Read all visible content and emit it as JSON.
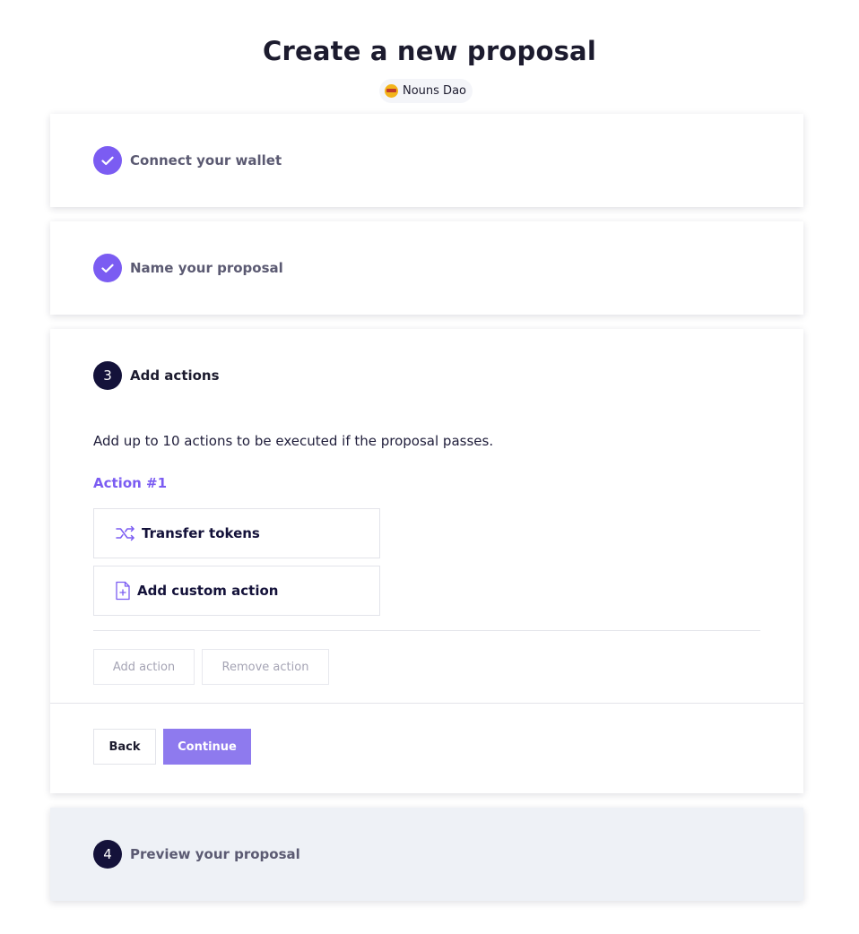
{
  "header": {
    "title": "Create a new proposal",
    "dao_name": "Nouns Dao"
  },
  "steps": [
    {
      "label": "Connect your wallet",
      "status": "done"
    },
    {
      "label": "Name your proposal",
      "status": "done"
    },
    {
      "number": "3",
      "label": "Add actions",
      "status": "active"
    },
    {
      "number": "4",
      "label": "Preview your proposal",
      "status": "upcoming"
    }
  ],
  "actions": {
    "description": "Add up to 10 actions to be executed if the proposal passes.",
    "action_title": "Action #1",
    "options": [
      {
        "label": "Transfer tokens",
        "icon": "shuffle-icon"
      },
      {
        "label": "Add custom action",
        "icon": "file-plus-icon"
      }
    ],
    "add_label": "Add action",
    "remove_label": "Remove action"
  },
  "nav": {
    "back_label": "Back",
    "continue_label": "Continue"
  },
  "colors": {
    "accent": "#7b5cf2",
    "continue_bg": "#8e7aee",
    "dark": "#14123a",
    "muted_card": "#eef1f6"
  }
}
